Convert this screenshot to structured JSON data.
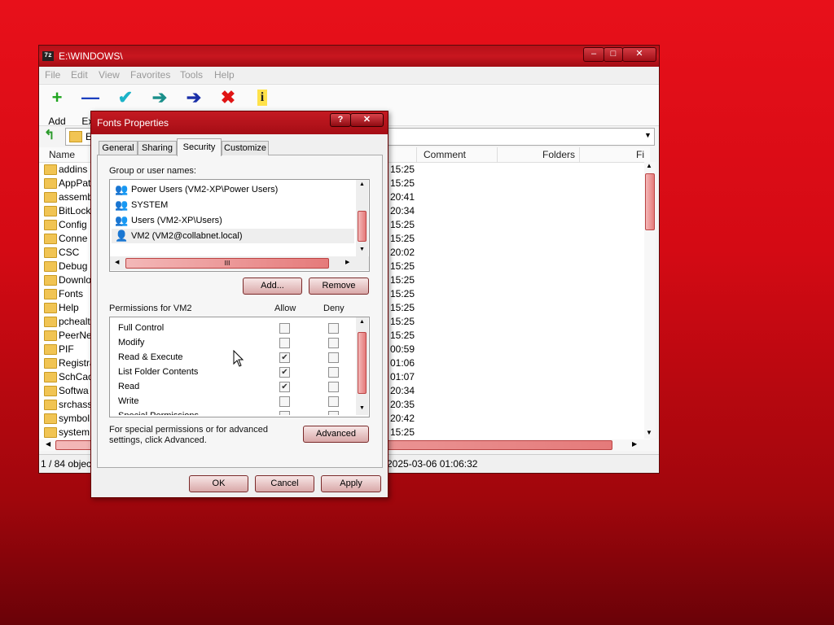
{
  "zip": {
    "title": "E:\\WINDOWS\\",
    "app_icon": "7z",
    "caption_buttons": {
      "minimize": "–",
      "maximize": "□",
      "close": "✕"
    },
    "menu": [
      "File",
      "Edit",
      "View",
      "Favorites",
      "Tools",
      "Help"
    ],
    "toolbar": [
      {
        "label": "Add",
        "icon": "+"
      },
      {
        "label": "Extr",
        "icon": "—"
      },
      {
        "label": "",
        "icon": "✔"
      },
      {
        "label": "",
        "icon": "➔"
      },
      {
        "label": "",
        "icon": "➔"
      },
      {
        "label": "",
        "icon": "✖"
      },
      {
        "label": "",
        "icon": "i"
      }
    ],
    "address_text": "E",
    "columns": [
      "Name",
      "Comment",
      "Folders",
      "Fi"
    ],
    "files": [
      {
        "name": "addins",
        "time": "15:25"
      },
      {
        "name": "AppPat",
        "time": "15:25"
      },
      {
        "name": "assemb",
        "time": "20:41"
      },
      {
        "name": "BitLock",
        "time": "20:34"
      },
      {
        "name": "Config",
        "time": "15:25"
      },
      {
        "name": "Conne",
        "time": "15:25"
      },
      {
        "name": "CSC",
        "time": "20:02"
      },
      {
        "name": "Debug",
        "time": "15:25"
      },
      {
        "name": "Downlo",
        "time": "15:25"
      },
      {
        "name": "Fonts",
        "time": "15:25"
      },
      {
        "name": "Help",
        "time": "15:25"
      },
      {
        "name": "pchealt",
        "time": "15:25"
      },
      {
        "name": "PeerNe",
        "time": "15:25"
      },
      {
        "name": "PIF",
        "time": "00:59"
      },
      {
        "name": "Registra",
        "time": "01:06"
      },
      {
        "name": "SchCac",
        "time": "01:07"
      },
      {
        "name": "Softwa",
        "time": "20:34"
      },
      {
        "name": "srchass",
        "time": "20:35"
      },
      {
        "name": "symbol",
        "time": "20:42"
      },
      {
        "name": "system",
        "time": "15:25"
      }
    ],
    "status_left": "1 / 84 objec",
    "status_right": "2025-03-06 01:06:32"
  },
  "dialog": {
    "title": "Fonts Properties",
    "caption_help": "?",
    "caption_close": "✕",
    "tabs": [
      "General",
      "Sharing",
      "Security",
      "Customize"
    ],
    "group_label": "Group or user names:",
    "users": [
      "Power Users (VM2-XP\\Power Users)",
      "SYSTEM",
      "Users (VM2-XP\\Users)",
      "VM2 (VM2@collabnet.local)"
    ],
    "hscroll_grip": "III",
    "add_button": "Add...",
    "remove_button": "Remove",
    "permissions_label": "Permissions for VM2",
    "allow_label": "Allow",
    "deny_label": "Deny",
    "permissions": [
      {
        "name": "Full Control",
        "allow": false,
        "deny": false
      },
      {
        "name": "Modify",
        "allow": false,
        "deny": false
      },
      {
        "name": "Read & Execute",
        "allow": true,
        "deny": false
      },
      {
        "name": "List Folder Contents",
        "allow": true,
        "deny": false
      },
      {
        "name": "Read",
        "allow": true,
        "deny": false
      },
      {
        "name": "Write",
        "allow": false,
        "deny": false
      },
      {
        "name": "Special Permissions",
        "allow": false,
        "deny": false
      }
    ],
    "advanced_text_1": "For special permissions or for advanced",
    "advanced_text_2": "settings, click Advanced.",
    "advanced_button": "Advanced",
    "ok": "OK",
    "cancel": "Cancel",
    "apply": "Apply"
  },
  "colors": {
    "accent": "#c8161f",
    "desktop": "#d40a14"
  }
}
